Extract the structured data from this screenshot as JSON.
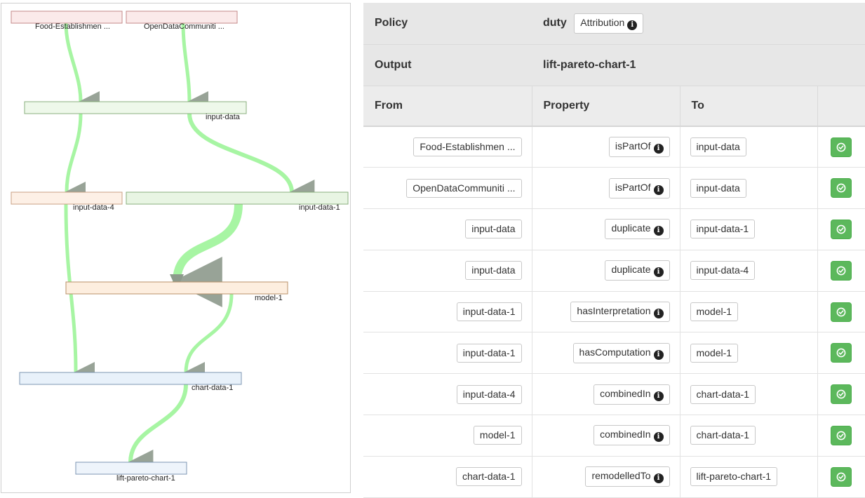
{
  "graph": {
    "nodes": [
      {
        "id": "food",
        "label": "Food-Establishmen ...",
        "fill": "#fbeaea",
        "stroke": "#c58a8a"
      },
      {
        "id": "odc",
        "label": "OpenDataCommuniti ...",
        "fill": "#fbeaea",
        "stroke": "#c58a8a"
      },
      {
        "id": "input-data",
        "label": "input-data",
        "fill": "#eef8ea",
        "stroke": "#8aaf7e"
      },
      {
        "id": "input-data-4",
        "label": "input-data-4",
        "fill": "#fdf0e6",
        "stroke": "#c9a184"
      },
      {
        "id": "input-data-1",
        "label": "input-data-1",
        "fill": "#e8f5e3",
        "stroke": "#8aaf7e"
      },
      {
        "id": "model-1",
        "label": "model-1",
        "fill": "#fdeedf",
        "stroke": "#b9906a"
      },
      {
        "id": "chart-data-1",
        "label": "chart-data-1",
        "fill": "#e8f1fa",
        "stroke": "#7e96b3"
      },
      {
        "id": "lift-pareto-chart-1",
        "label": "lift-pareto-chart-1",
        "fill": "#eef4fb",
        "stroke": "#7e96b3"
      }
    ],
    "edge_color": "#9ef49a",
    "arrow_color": "#8d9a8c"
  },
  "table": {
    "policy_label": "Policy",
    "duty_label": "duty",
    "attribution_label": "Attribution",
    "output_label": "Output",
    "output_value": "lift-pareto-chart-1",
    "headers": {
      "from": "From",
      "property": "Property",
      "to": "To"
    },
    "rows": [
      {
        "from": "Food-Establishmen ...",
        "property": "isPartOf",
        "to": "input-data"
      },
      {
        "from": "OpenDataCommuniti ...",
        "property": "isPartOf",
        "to": "input-data"
      },
      {
        "from": "input-data",
        "property": "duplicate",
        "to": "input-data-1"
      },
      {
        "from": "input-data",
        "property": "duplicate",
        "to": "input-data-4"
      },
      {
        "from": "input-data-1",
        "property": "hasInterpretation",
        "to": "model-1"
      },
      {
        "from": "input-data-1",
        "property": "hasComputation",
        "to": "model-1"
      },
      {
        "from": "input-data-4",
        "property": "combinedIn",
        "to": "chart-data-1"
      },
      {
        "from": "model-1",
        "property": "combinedIn",
        "to": "chart-data-1"
      },
      {
        "from": "chart-data-1",
        "property": "remodelledTo",
        "to": "lift-pareto-chart-1"
      }
    ],
    "action_color": "#5cb85c",
    "info_icon": "info-circle-icon",
    "action_icon": "check-circle-icon"
  }
}
